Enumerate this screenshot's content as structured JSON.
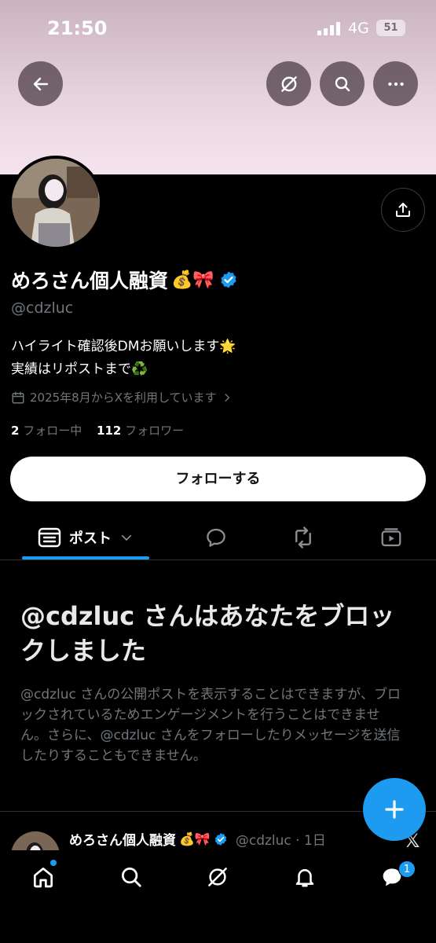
{
  "status_bar": {
    "time": "21:50",
    "network": "4G",
    "battery": "51"
  },
  "profile": {
    "display_name": "めろさん個人融資",
    "name_emoji": "💰🎀",
    "handle": "@cdzluc",
    "bio_line1": "ハイライト確認後DMお願いします🌟",
    "bio_line2": "実績はリポストまで♻️",
    "joined": "2025年8月からXを利用しています",
    "following_count": "2",
    "following_label": "フォロー中",
    "followers_count": "112",
    "followers_label": "フォロワー"
  },
  "follow_button": "フォローする",
  "tabs": {
    "posts_label": "ポスト"
  },
  "blocked": {
    "title": "@cdzluc さんはあなたをブロックしました",
    "body": "@cdzluc さんの公開ポストを表示することはできますが、ブロックされているためエンゲージメントを行うことはできません。さらに、@cdzluc さんをフォローしたりメッセージを送信したりすることもできません。"
  },
  "peek_post": {
    "name": "めろさん個人融資",
    "emoji": "💰🎀",
    "meta": "@cdzluc · 1日",
    "x_mark": "𝕏"
  },
  "nav": {
    "messages_badge": "1"
  },
  "colors": {
    "accent": "#1d9bf0",
    "background": "#000000",
    "muted": "#71767b"
  }
}
